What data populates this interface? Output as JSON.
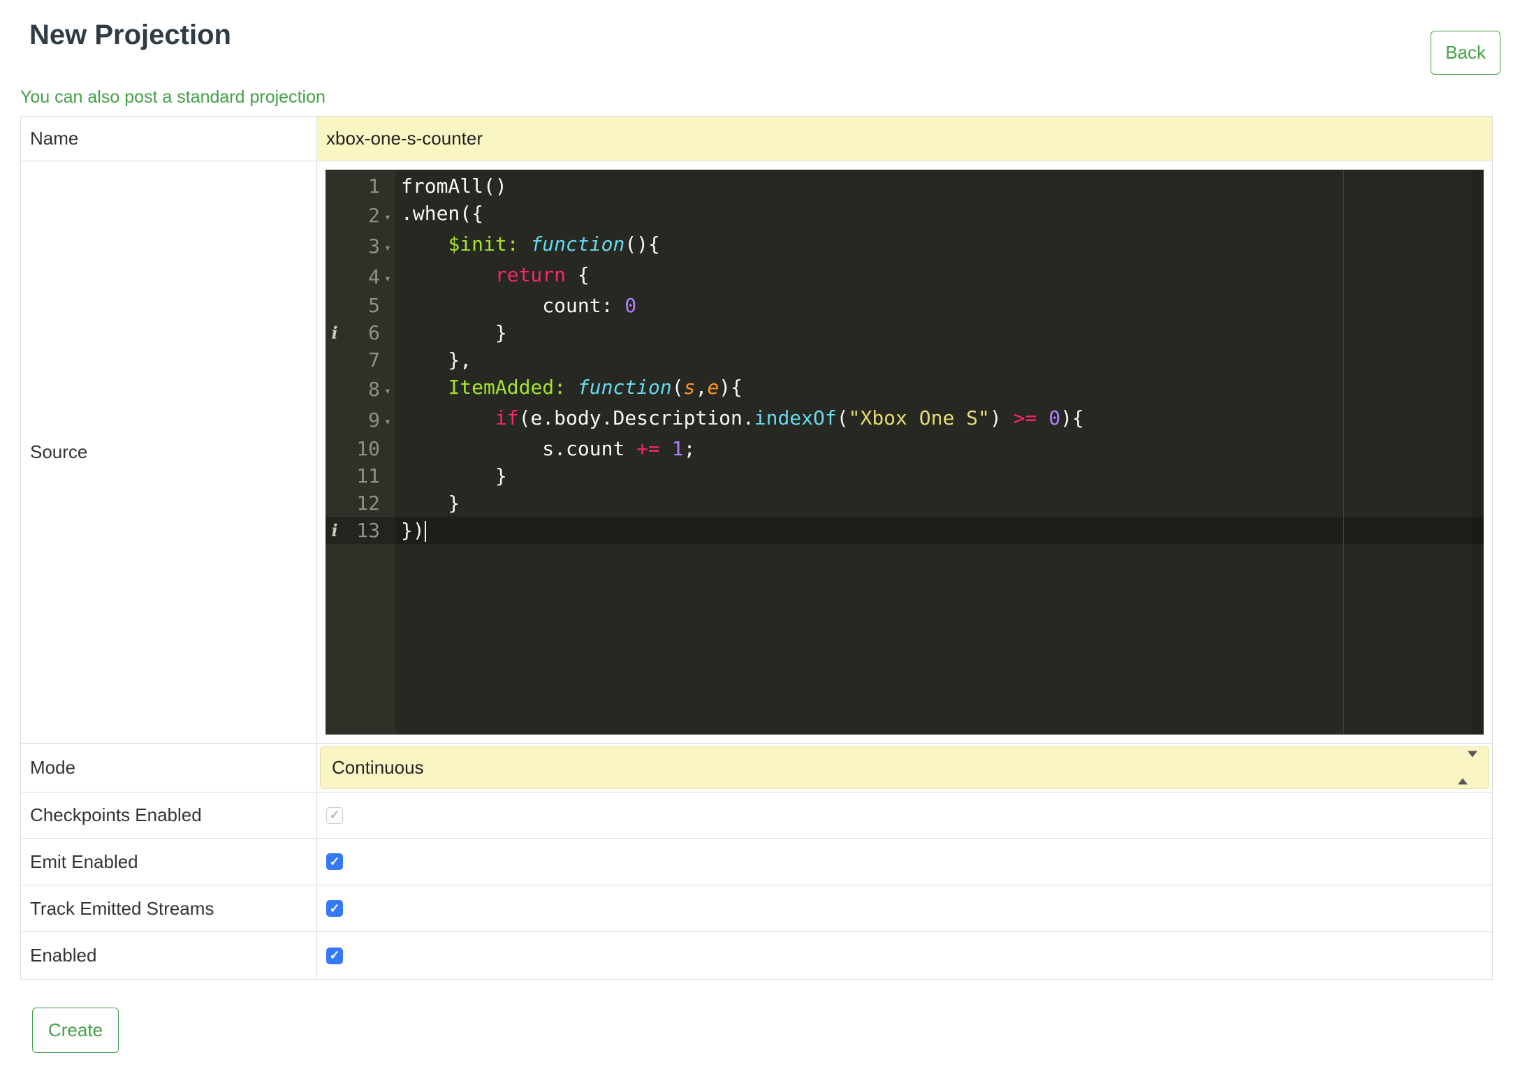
{
  "colors": {
    "green": "#43A047",
    "input_yellow": "#FAF6C4",
    "checkbox_blue": "#3579F6",
    "editor_background": "#272822",
    "editor_gutter": "#2F3129"
  },
  "header": {
    "title": "New Projection",
    "back_button": "Back"
  },
  "link": {
    "standard_projection": "You can also post a standard projection"
  },
  "form": {
    "labels": {
      "name": "Name",
      "source": "Source",
      "mode": "Mode",
      "checkpoints": "Checkpoints Enabled",
      "emit": "Emit Enabled",
      "track": "Track Emitted Streams",
      "enabled": "Enabled"
    },
    "name_value": "xbox-one-s-counter",
    "mode_value": "Continuous",
    "checkboxes": {
      "checkpoints": {
        "checked": true,
        "disabled": true
      },
      "emit": {
        "checked": true,
        "disabled": false
      },
      "track": {
        "checked": true,
        "disabled": false
      },
      "enabled": {
        "checked": true,
        "disabled": false
      }
    },
    "create_button": "Create"
  },
  "editor": {
    "theme": "monokai",
    "info_icon_glyph": "i",
    "fold_icon_glyph": "▾",
    "lines": [
      {
        "num": 1,
        "segments": [
          [
            "p",
            "fromAll()"
          ]
        ]
      },
      {
        "num": 2,
        "fold": true,
        "segments": [
          [
            "p",
            ".when({"
          ]
        ]
      },
      {
        "num": 3,
        "fold": true,
        "segments": [
          [
            "p",
            "    "
          ],
          [
            "g",
            "$init:"
          ],
          [
            "p",
            " "
          ],
          [
            "f",
            "function"
          ],
          [
            "p",
            "(){"
          ]
        ]
      },
      {
        "num": 4,
        "fold": true,
        "segments": [
          [
            "p",
            "        "
          ],
          [
            "k",
            "return"
          ],
          [
            "p",
            " {"
          ]
        ]
      },
      {
        "num": 5,
        "segments": [
          [
            "p",
            "            count: "
          ],
          [
            "n",
            "0"
          ]
        ]
      },
      {
        "num": 6,
        "info": true,
        "segments": [
          [
            "p",
            "        }"
          ]
        ]
      },
      {
        "num": 7,
        "segments": [
          [
            "p",
            "    },"
          ]
        ]
      },
      {
        "num": 8,
        "fold": true,
        "segments": [
          [
            "p",
            "    "
          ],
          [
            "g",
            "ItemAdded:"
          ],
          [
            "p",
            " "
          ],
          [
            "f",
            "function"
          ],
          [
            "p",
            "("
          ],
          [
            "o",
            "s"
          ],
          [
            "p",
            ","
          ],
          [
            "o",
            "e"
          ],
          [
            "p",
            "){"
          ]
        ]
      },
      {
        "num": 9,
        "fold": true,
        "segments": [
          [
            "p",
            "        "
          ],
          [
            "k",
            "if"
          ],
          [
            "p",
            "(e.body.Description."
          ],
          [
            "c",
            "indexOf"
          ],
          [
            "p",
            "("
          ],
          [
            "s",
            "\"Xbox One S\""
          ],
          [
            "p",
            ") "
          ],
          [
            "k",
            ">="
          ],
          [
            "p",
            " "
          ],
          [
            "n",
            "0"
          ],
          [
            "p",
            "){"
          ]
        ]
      },
      {
        "num": 10,
        "segments": [
          [
            "p",
            "            s.count "
          ],
          [
            "k",
            "+="
          ],
          [
            "p",
            " "
          ],
          [
            "n",
            "1"
          ],
          [
            "p",
            ";"
          ]
        ]
      },
      {
        "num": 11,
        "segments": [
          [
            "p",
            "        }"
          ]
        ]
      },
      {
        "num": 12,
        "segments": [
          [
            "p",
            "    }"
          ]
        ]
      },
      {
        "num": 13,
        "info": true,
        "active": true,
        "cursor": true,
        "segments": [
          [
            "p",
            "})"
          ]
        ]
      }
    ]
  }
}
